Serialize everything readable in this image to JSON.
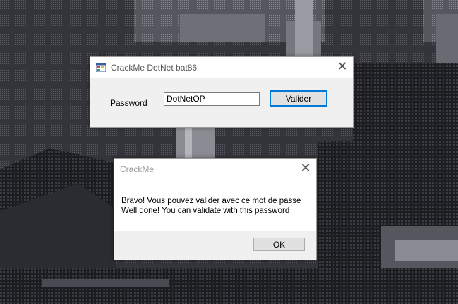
{
  "main_window": {
    "title": "CrackMe DotNet bat86",
    "close_glyph": "✕",
    "icon": "app-window-icon",
    "password_label": "Password",
    "password_value": "DotNetOP",
    "submit_label": "Valider"
  },
  "message_box": {
    "title": "CrackMe",
    "close_glyph": "✕",
    "message_line1": "Bravo! Vous pouvez valider avec ce mot de passe",
    "message_line2": "Well done! You can validate with this password",
    "ok_label": "OK"
  },
  "colors": {
    "accent_border": "#0078d7",
    "window_bg": "#f0f0f0",
    "titlebar_bg": "#ffffff",
    "title_text": "#9a9a9a"
  }
}
